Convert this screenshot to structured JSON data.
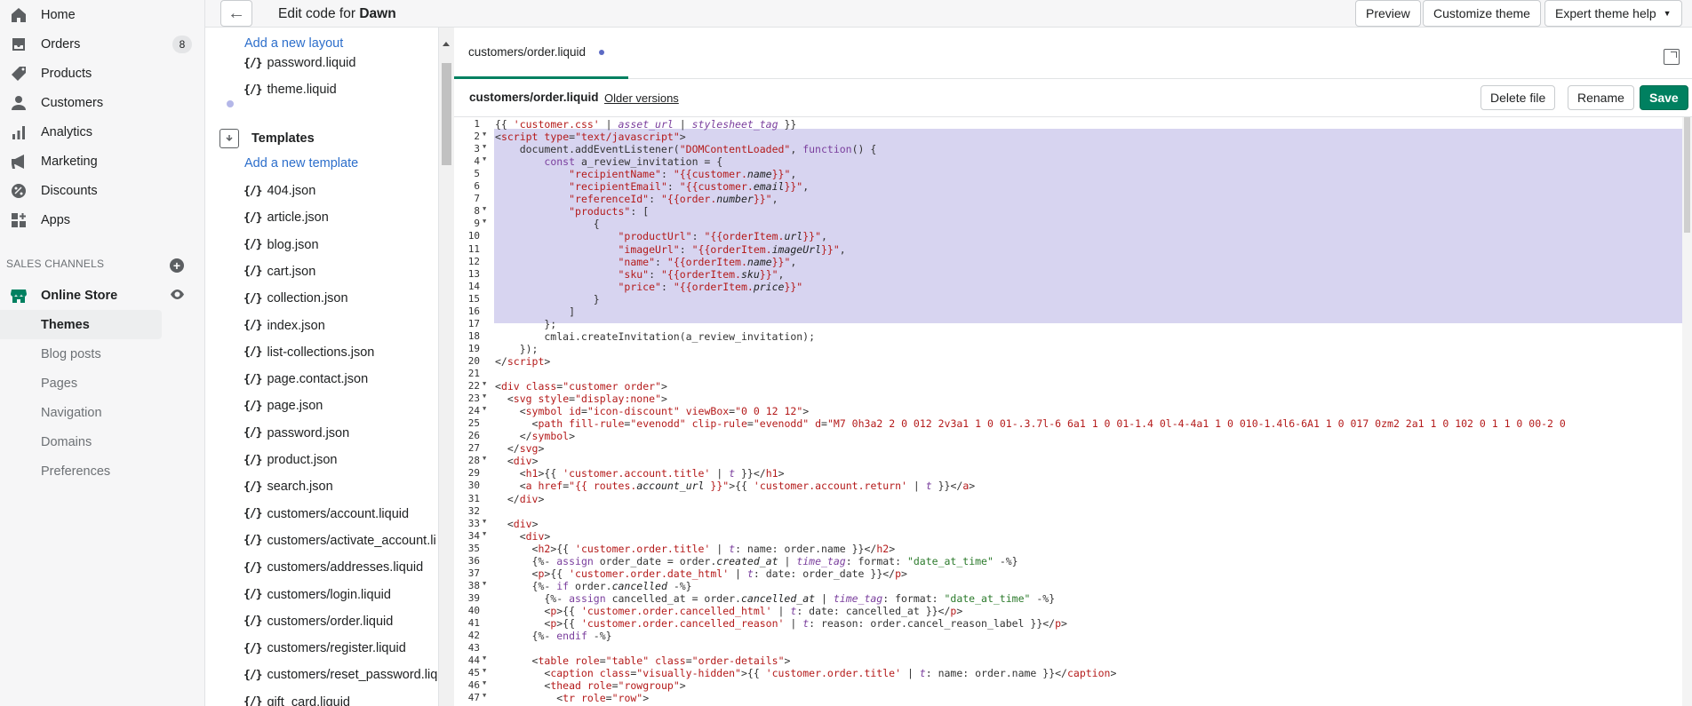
{
  "nav": {
    "items": [
      {
        "id": "home",
        "label": "Home",
        "icon": "home-icon"
      },
      {
        "id": "orders",
        "label": "Orders",
        "icon": "orders-icon",
        "badge": "8"
      },
      {
        "id": "products",
        "label": "Products",
        "icon": "tag-icon"
      },
      {
        "id": "customers",
        "label": "Customers",
        "icon": "person-icon"
      },
      {
        "id": "analytics",
        "label": "Analytics",
        "icon": "bar-chart-icon"
      },
      {
        "id": "marketing",
        "label": "Marketing",
        "icon": "megaphone-icon"
      },
      {
        "id": "discounts",
        "label": "Discounts",
        "icon": "discount-icon"
      },
      {
        "id": "apps",
        "label": "Apps",
        "icon": "apps-icon"
      }
    ],
    "sales_channels_label": "SALES CHANNELS",
    "online_store": "Online Store",
    "sub_items": [
      "Themes",
      "Blog posts",
      "Pages",
      "Navigation",
      "Domains",
      "Preferences"
    ]
  },
  "topbar": {
    "title_prefix": "Edit code for",
    "theme_name": "Dawn",
    "preview": "Preview",
    "customize": "Customize theme",
    "expert_help": "Expert theme help"
  },
  "tree": {
    "add_layout": "Add a new layout",
    "layout_files": [
      "password.liquid",
      "theme.liquid"
    ],
    "templates_heading": "Templates",
    "add_template": "Add a new template",
    "template_files": [
      "404.json",
      "article.json",
      "blog.json",
      "cart.json",
      "collection.json",
      "index.json",
      "list-collections.json",
      "page.contact.json",
      "page.json",
      "password.json",
      "product.json",
      "search.json",
      "customers/account.liquid",
      "customers/activate_account.li",
      "customers/addresses.liquid",
      "customers/login.liquid",
      "customers/order.liquid",
      "customers/register.liquid",
      "customers/reset_password.liq",
      "gift_card.liquid"
    ]
  },
  "editor": {
    "tab_label": "customers/order.liquid",
    "file_name": "customers/order.liquid",
    "older_versions": "Older versions",
    "delete_file": "Delete file",
    "rename": "Rename",
    "save": "Save"
  },
  "colors": {
    "accent_green": "#008060",
    "selection": "#d7d4f0",
    "link": "#2c6ecb"
  }
}
